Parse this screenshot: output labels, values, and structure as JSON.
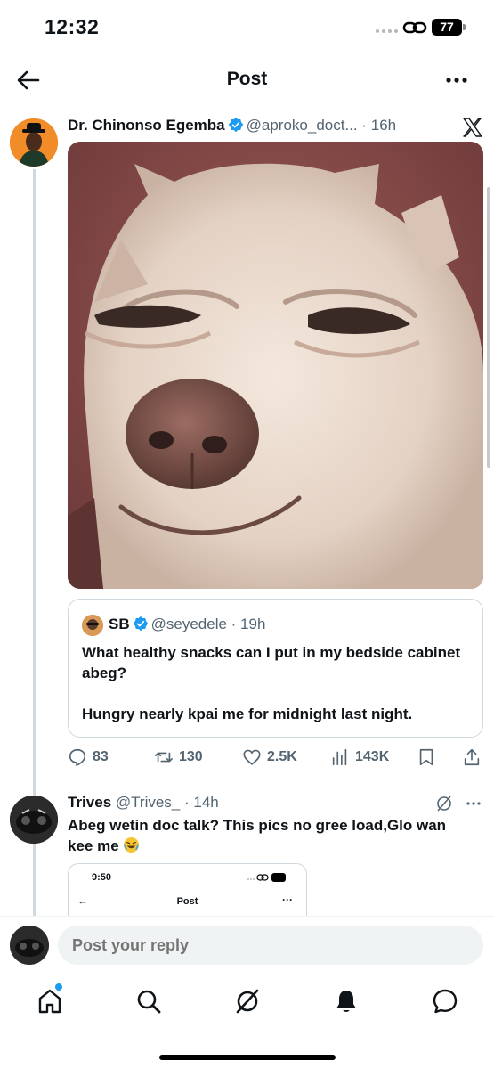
{
  "status_bar": {
    "time": "12:32",
    "battery": "77"
  },
  "header": {
    "title": "Post"
  },
  "post": {
    "author_name": "Dr. Chinonso Egemba",
    "handle": "@aproko_doct...",
    "time": "16h",
    "quote": {
      "author_name": "SB",
      "handle": "@seyedele",
      "time": "19h",
      "text_line1": "What healthy snacks can I put in my bedside cabinet abeg?",
      "text_line2": "Hungry nearly kpai me for midnight last night."
    },
    "stats": {
      "replies": "83",
      "reposts": "130",
      "likes": "2.5K",
      "views": "143K"
    }
  },
  "reply": {
    "author_name": "Trives",
    "handle": "@Trives_",
    "time": "14h",
    "text": "Abeg wetin doc talk? This pics no gree load,Glo wan kee me",
    "embedded_screenshot": {
      "time": "9:50",
      "battery": "43",
      "title": "Post"
    }
  },
  "composer": {
    "placeholder": "Post your reply"
  },
  "colors": {
    "accent": "#1d9bf0",
    "muted": "#536471",
    "border": "#cfd9de"
  },
  "icons": [
    "back-arrow-icon",
    "more-icon",
    "verified-badge-icon",
    "x-logo-icon",
    "reply-icon",
    "repost-icon",
    "like-icon",
    "views-icon",
    "bookmark-icon",
    "share-icon",
    "grok-icon",
    "home-icon",
    "search-icon",
    "grok-icon",
    "bell-icon",
    "messages-icon"
  ]
}
